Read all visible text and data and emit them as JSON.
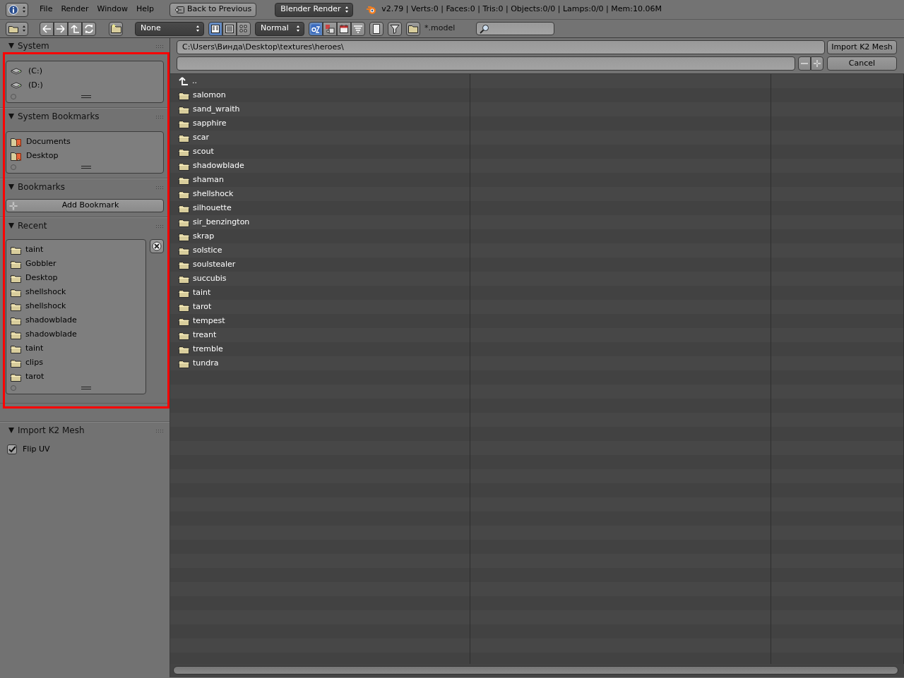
{
  "header": {
    "menus": [
      "File",
      "Render",
      "Window",
      "Help"
    ],
    "back_button": "Back to Previous",
    "render_engine": "Blender Render",
    "stats": "v2.79 | Verts:0 | Faces:0 | Tris:0 | Objects:0/0 | Lamps:0/0 | Mem:10.06M"
  },
  "toolbar": {
    "recursion": "None",
    "display_modes": [
      {
        "selected": true
      },
      {
        "selected": false
      },
      {
        "selected": false
      }
    ],
    "display_size": "Normal",
    "sort_modes": [
      {
        "selected": true
      },
      {
        "selected": false
      },
      {
        "selected": false
      },
      {
        "selected": false
      }
    ],
    "filter_glob": "*.model"
  },
  "sidebar": {
    "panels": [
      {
        "title": "System",
        "kind": "drives",
        "expanded": true,
        "items": [
          "(C:)",
          "(D:)"
        ]
      },
      {
        "title": "System Bookmarks",
        "kind": "bookmarks",
        "expanded": true,
        "items": [
          "Documents",
          "Desktop"
        ]
      },
      {
        "title": "Bookmarks",
        "kind": "button",
        "expanded": true,
        "button": "Add Bookmark"
      },
      {
        "title": "Recent",
        "kind": "recent",
        "expanded": true,
        "items": [
          "taint",
          "Gobbler",
          "Desktop",
          "shellshock",
          "shellshock",
          "shadowblade",
          "shadowblade",
          "taint",
          "clips",
          "tarot"
        ]
      }
    ],
    "operator_panel": {
      "title": "Import K2 Mesh",
      "expanded": true,
      "options": [
        {
          "label": "Flip UV",
          "checked": true
        }
      ]
    }
  },
  "file_browser": {
    "path": "C:\\Users\\Винда\\Desktop\\textures\\heroes\\",
    "confirm_button": "Import K2 Mesh",
    "cancel_button": "Cancel",
    "parent": "..",
    "files": [
      "salomon",
      "sand_wraith",
      "sapphire",
      "scar",
      "scout",
      "shadowblade",
      "shaman",
      "shellshock",
      "silhouette",
      "sir_benzington",
      "skrap",
      "solstice",
      "soulstealer",
      "succubis",
      "taint",
      "tarot",
      "tempest",
      "treant",
      "tremble",
      "tundra"
    ]
  }
}
